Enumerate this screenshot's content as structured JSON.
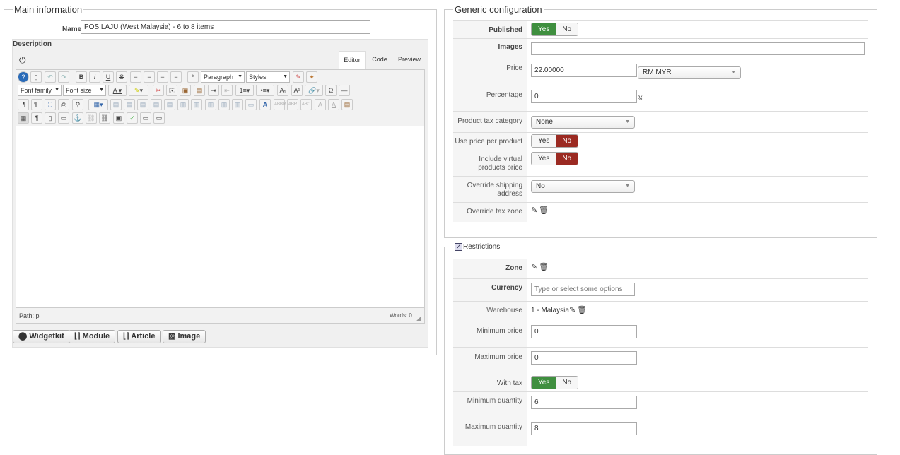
{
  "main": {
    "legend": "Main information",
    "name_label": "Name",
    "name_value": "POS LAJU (West Malaysia) - 6 to 8 items",
    "description_label": "Description",
    "tabs": [
      "Editor",
      "Code",
      "Preview"
    ],
    "toolbar": {
      "paragraph": "Paragraph",
      "styles": "Styles",
      "font_family": "Font family",
      "font_size": "Font size"
    },
    "path_label": "Path: p",
    "words_label": "Words: 0",
    "buttons": [
      "Widgetkit",
      "Module",
      "Article",
      "Image"
    ]
  },
  "generic": {
    "legend": "Generic configuration",
    "published_label": "Published",
    "yes": "Yes",
    "no": "No",
    "images_label": "Images",
    "price_label": "Price",
    "price_value": "22.00000",
    "currency_value": "RM MYR",
    "percentage_label": "Percentage",
    "percentage_value": "0",
    "percent_sign": "%",
    "tax_category_label": "Product tax category",
    "tax_category_value": "None",
    "price_per_product_label": "Use price per product",
    "include_virtual_label_1": "Include virtual",
    "include_virtual_label_2": "products price",
    "override_shipping_label_1": "Override shipping",
    "override_shipping_label_2": "address",
    "override_shipping_value": "No",
    "override_tax_label": "Override tax zone"
  },
  "restrictions": {
    "legend": "Restrictions",
    "zone_label": "Zone",
    "currency_label": "Currency",
    "currency_placeholder": "Type or select some options",
    "warehouse_label": "Warehouse",
    "warehouse_value": "1 - Malaysia",
    "min_price_label": "Minimum price",
    "min_price_value": "0",
    "max_price_label": "Maximum price",
    "max_price_value": "0",
    "with_tax_label": "With tax",
    "min_qty_label": "Minimum quantity",
    "min_qty_value": "6",
    "max_qty_label": "Maximum quantity",
    "max_qty_value": "8"
  }
}
